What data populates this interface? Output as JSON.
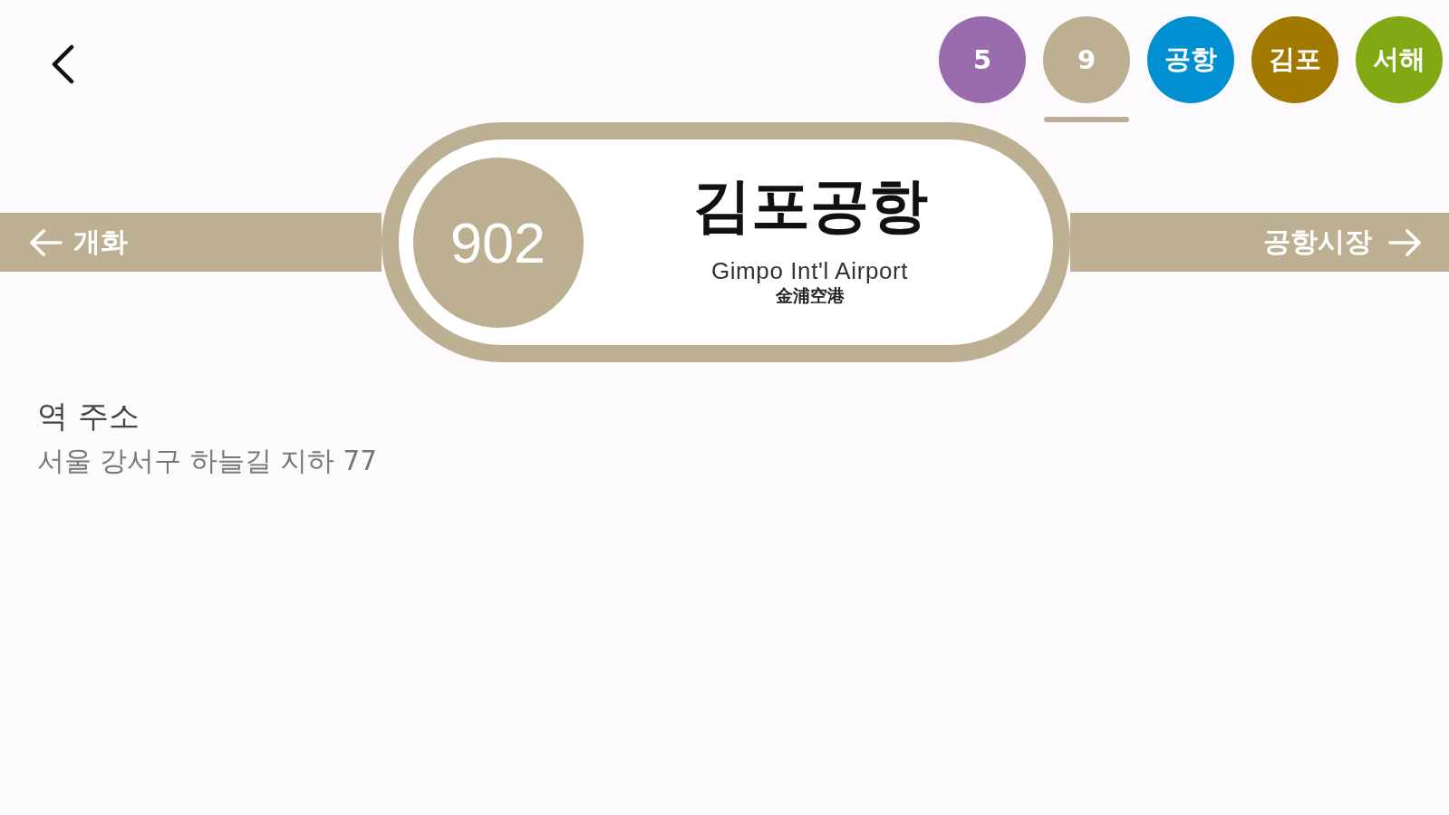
{
  "line_tabs": [
    {
      "label": "5",
      "color": "#996cae",
      "selected": false
    },
    {
      "label": "9",
      "color": "#bdb092",
      "selected": true
    },
    {
      "label": "공항",
      "color": "#0090d2",
      "selected": false
    },
    {
      "label": "김포",
      "color": "#a17800",
      "selected": false
    },
    {
      "label": "서해",
      "color": "#81a914",
      "selected": false
    }
  ],
  "station_sign": {
    "number": "902",
    "name": "김포공항",
    "name_english": "Gimpo Int'l Airport",
    "name_hanja": "金浦空港",
    "previous_station": "개화",
    "next_station": "공항시장"
  },
  "address": {
    "heading": "역 주소",
    "value": "서울 강서구 하늘길 지하 77"
  }
}
